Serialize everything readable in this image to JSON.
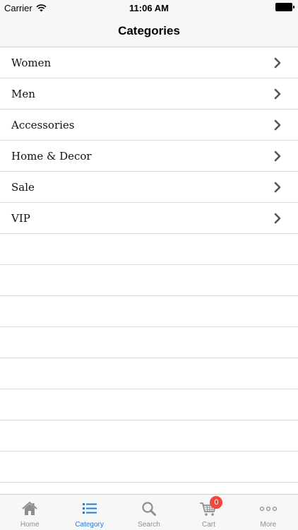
{
  "status_bar": {
    "carrier": "Carrier",
    "time": "11:06 AM"
  },
  "nav": {
    "title": "Categories"
  },
  "categories": [
    {
      "label": "Women"
    },
    {
      "label": "Men"
    },
    {
      "label": "Accessories"
    },
    {
      "label": "Home & Decor"
    },
    {
      "label": "Sale"
    },
    {
      "label": "VIP"
    }
  ],
  "tab_bar": {
    "items": [
      {
        "label": "Home",
        "icon": "house-icon"
      },
      {
        "label": "Category",
        "icon": "list-icon",
        "active": true
      },
      {
        "label": "Search",
        "icon": "magnifier-icon"
      },
      {
        "label": "Cart",
        "icon": "cart-icon",
        "badge": "0"
      },
      {
        "label": "More",
        "icon": "ellipsis-icon"
      }
    ]
  },
  "colors": {
    "accent": "#1a7ee0",
    "badge": "#f2473f",
    "inactive": "#8e8e8e"
  }
}
